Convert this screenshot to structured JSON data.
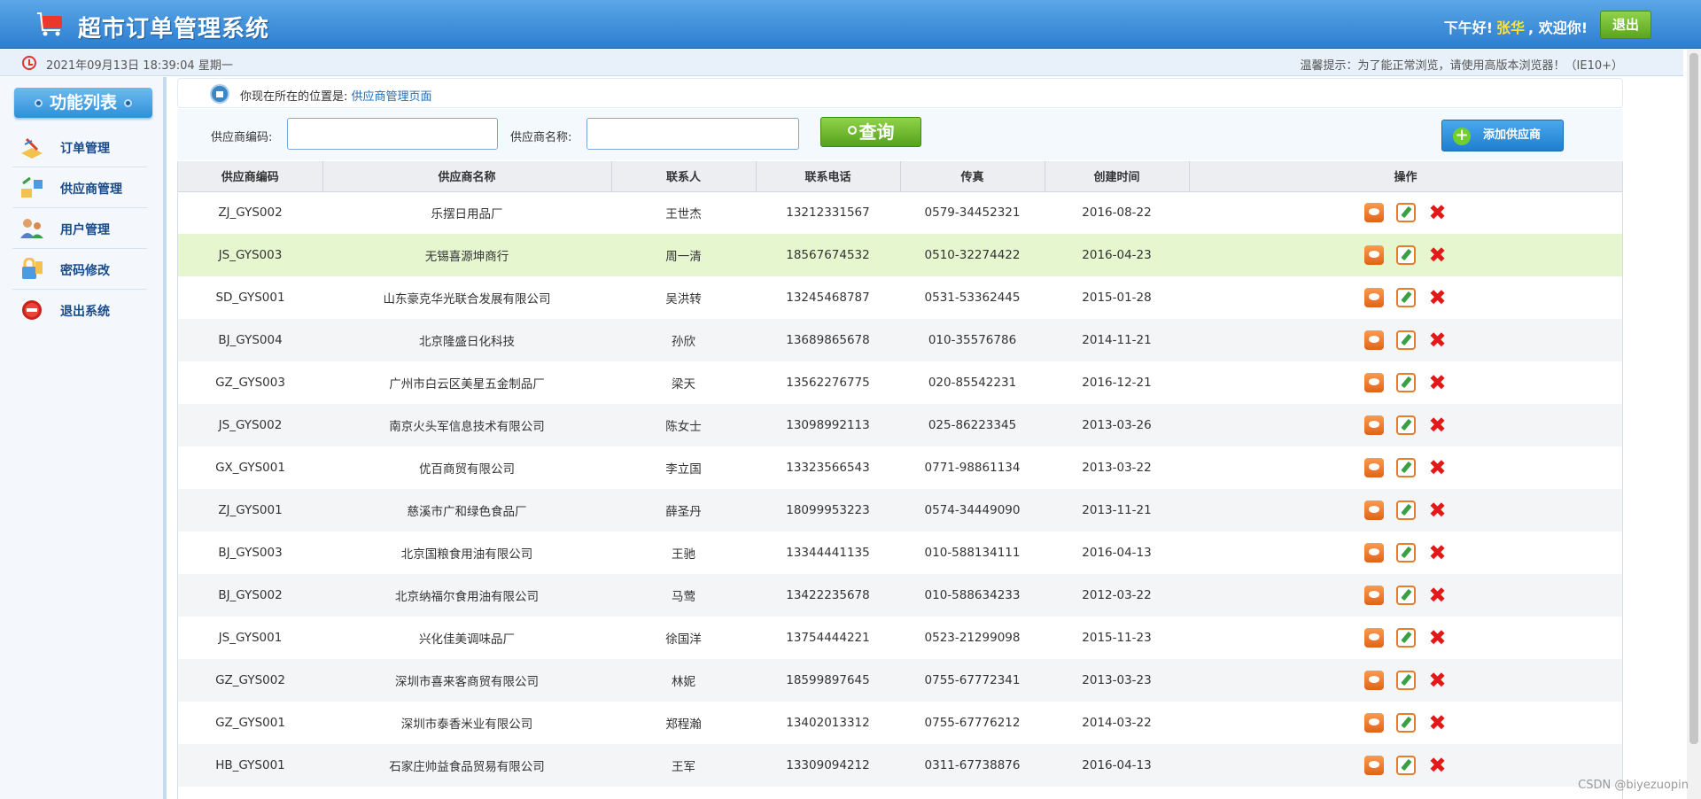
{
  "header": {
    "title": "超市订单管理系统",
    "greeting_prefix": "下午好!",
    "username": "张华",
    "greeting_suffix": ", 欢迎你!",
    "logout_label": "退出",
    "logo_icon": "shopping-cart-icon"
  },
  "subbar": {
    "datetime": "2021年09月13日 18:39:04 星期一",
    "tip": "温馨提示：为了能正常浏览，请使用高版本浏览器！（IE10+）"
  },
  "sidebar": {
    "title": "功能列表",
    "items": [
      {
        "label": "订单管理",
        "icon": "order-icon"
      },
      {
        "label": "供应商管理",
        "icon": "provider-icon"
      },
      {
        "label": "用户管理",
        "icon": "users-icon"
      },
      {
        "label": "密码修改",
        "icon": "lock-icon"
      },
      {
        "label": "退出系统",
        "icon": "exit-icon"
      }
    ]
  },
  "breadcrumb": {
    "prefix": "你现在所在的位置是:",
    "current": "供应商管理页面"
  },
  "search": {
    "code_label": "供应商编码:",
    "code_value": "",
    "name_label": "供应商名称:",
    "name_value": "",
    "query_label": "查询",
    "add_label": "添加供应商"
  },
  "table": {
    "columns": [
      "供应商编码",
      "供应商名称",
      "联系人",
      "联系电话",
      "传真",
      "创建时间",
      "操作"
    ],
    "rows": [
      {
        "code": "ZJ_GYS002",
        "name": "乐摆日用品厂",
        "contact": "王世杰",
        "phone": "13212331567",
        "fax": "0579-34452321",
        "date": "2016-08-22"
      },
      {
        "code": "JS_GYS003",
        "name": "无锡喜源坤商行",
        "contact": "周一清",
        "phone": "18567674532",
        "fax": "0510-32274422",
        "date": "2016-04-23"
      },
      {
        "code": "SD_GYS001",
        "name": "山东豪克华光联合发展有限公司",
        "contact": "吴洪转",
        "phone": "13245468787",
        "fax": "0531-53362445",
        "date": "2015-01-28"
      },
      {
        "code": "BJ_GYS004",
        "name": "北京隆盛日化科技",
        "contact": "孙欣",
        "phone": "13689865678",
        "fax": "010-35576786",
        "date": "2014-11-21"
      },
      {
        "code": "GZ_GYS003",
        "name": "广州市白云区美星五金制品厂",
        "contact": "梁天",
        "phone": "13562276775",
        "fax": "020-85542231",
        "date": "2016-12-21"
      },
      {
        "code": "JS_GYS002",
        "name": "南京火头军信息技术有限公司",
        "contact": "陈女士",
        "phone": "13098992113",
        "fax": "025-86223345",
        "date": "2013-03-26"
      },
      {
        "code": "GX_GYS001",
        "name": "优百商贸有限公司",
        "contact": "李立国",
        "phone": "13323566543",
        "fax": "0771-98861134",
        "date": "2013-03-22"
      },
      {
        "code": "ZJ_GYS001",
        "name": "慈溪市广和绿色食品厂",
        "contact": "薛圣丹",
        "phone": "18099953223",
        "fax": "0574-34449090",
        "date": "2013-11-21"
      },
      {
        "code": "BJ_GYS003",
        "name": "北京国粮食用油有限公司",
        "contact": "王驰",
        "phone": "13344441135",
        "fax": "010-588134111",
        "date": "2016-04-13"
      },
      {
        "code": "BJ_GYS002",
        "name": "北京纳福尔食用油有限公司",
        "contact": "马莺",
        "phone": "13422235678",
        "fax": "010-588634233",
        "date": "2012-03-22"
      },
      {
        "code": "JS_GYS001",
        "name": "兴化佳美调味品厂",
        "contact": "徐国洋",
        "phone": "13754444221",
        "fax": "0523-21299098",
        "date": "2015-11-23"
      },
      {
        "code": "GZ_GYS002",
        "name": "深圳市喜来客商贸有限公司",
        "contact": "林妮",
        "phone": "18599897645",
        "fax": "0755-67772341",
        "date": "2013-03-23"
      },
      {
        "code": "GZ_GYS001",
        "name": "深圳市泰香米业有限公司",
        "contact": "郑程瀚",
        "phone": "13402013312",
        "fax": "0755-67776212",
        "date": "2014-03-22"
      },
      {
        "code": "HB_GYS001",
        "name": "石家庄帅益食品贸易有限公司",
        "contact": "王军",
        "phone": "13309094212",
        "fax": "0311-67738876",
        "date": "2016-04-13"
      }
    ],
    "highlighted_row": 1,
    "action_icons": [
      "view-icon",
      "edit-icon",
      "delete-icon"
    ]
  },
  "watermark": "CSDN @biyezuopin",
  "colors": {
    "header_blue": "#2d7ed0",
    "accent_green": "#5aa51e",
    "link_blue": "#1b6fbf",
    "highlight_row": "#e6f6cf",
    "delete_red": "#e01919"
  }
}
